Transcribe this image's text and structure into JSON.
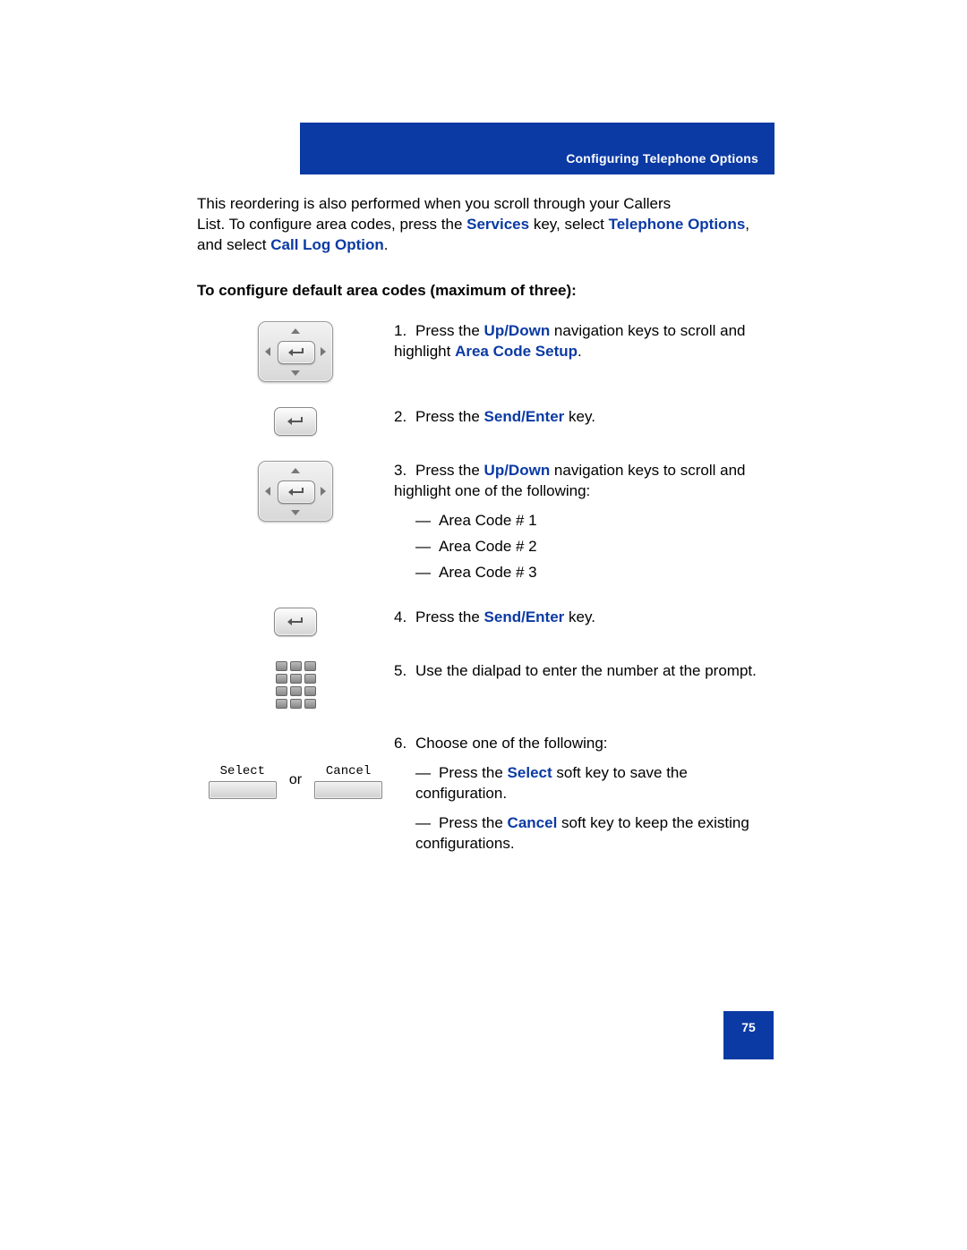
{
  "header": {
    "title": "Configuring Telephone Options"
  },
  "intro": {
    "line1a": "This reordering is also performed when you scroll through your Callers",
    "line2a": "List. To configure area codes, press the ",
    "services": "Services",
    "line2b": " key, select ",
    "telopt": "Telephone Options",
    "line3a": ", and select ",
    "calllog": "Call Log Option",
    "dot": "."
  },
  "section_heading": "To configure default area codes (maximum of three):",
  "steps": {
    "s1": {
      "num": "1.",
      "a": "Press the ",
      "updown": "Up/Down",
      "b": " navigation keys to scroll and highlight ",
      "area": "Area Code Setup",
      "dot": "."
    },
    "s2": {
      "num": "2.",
      "a": "Press the ",
      "send": "Send/Enter",
      "b": " key."
    },
    "s3": {
      "num": "3.",
      "a": "Press the ",
      "updown": "Up/Down",
      "b": " navigation keys to scroll and highlight one of the following:",
      "opts": [
        "Area Code # 1",
        "Area Code # 2",
        "Area Code # 3"
      ]
    },
    "s4": {
      "num": "4.",
      "a": "Press the ",
      "send": "Send/Enter",
      "b": " key."
    },
    "s5": {
      "num": "5.",
      "a": "Use the dialpad to enter the number at the prompt."
    },
    "s6": {
      "num": "6.",
      "a": "Choose one of the following:",
      "opt1a": "Press the ",
      "select": "Select",
      "opt1b": " soft key to save the configuration.",
      "opt2a": "Press the ",
      "cancel": "Cancel",
      "opt2b": " soft key to keep the existing configurations."
    }
  },
  "softkeys": {
    "select": "Select",
    "cancel": "Cancel",
    "or": "or"
  },
  "footer": {
    "page": "75"
  }
}
